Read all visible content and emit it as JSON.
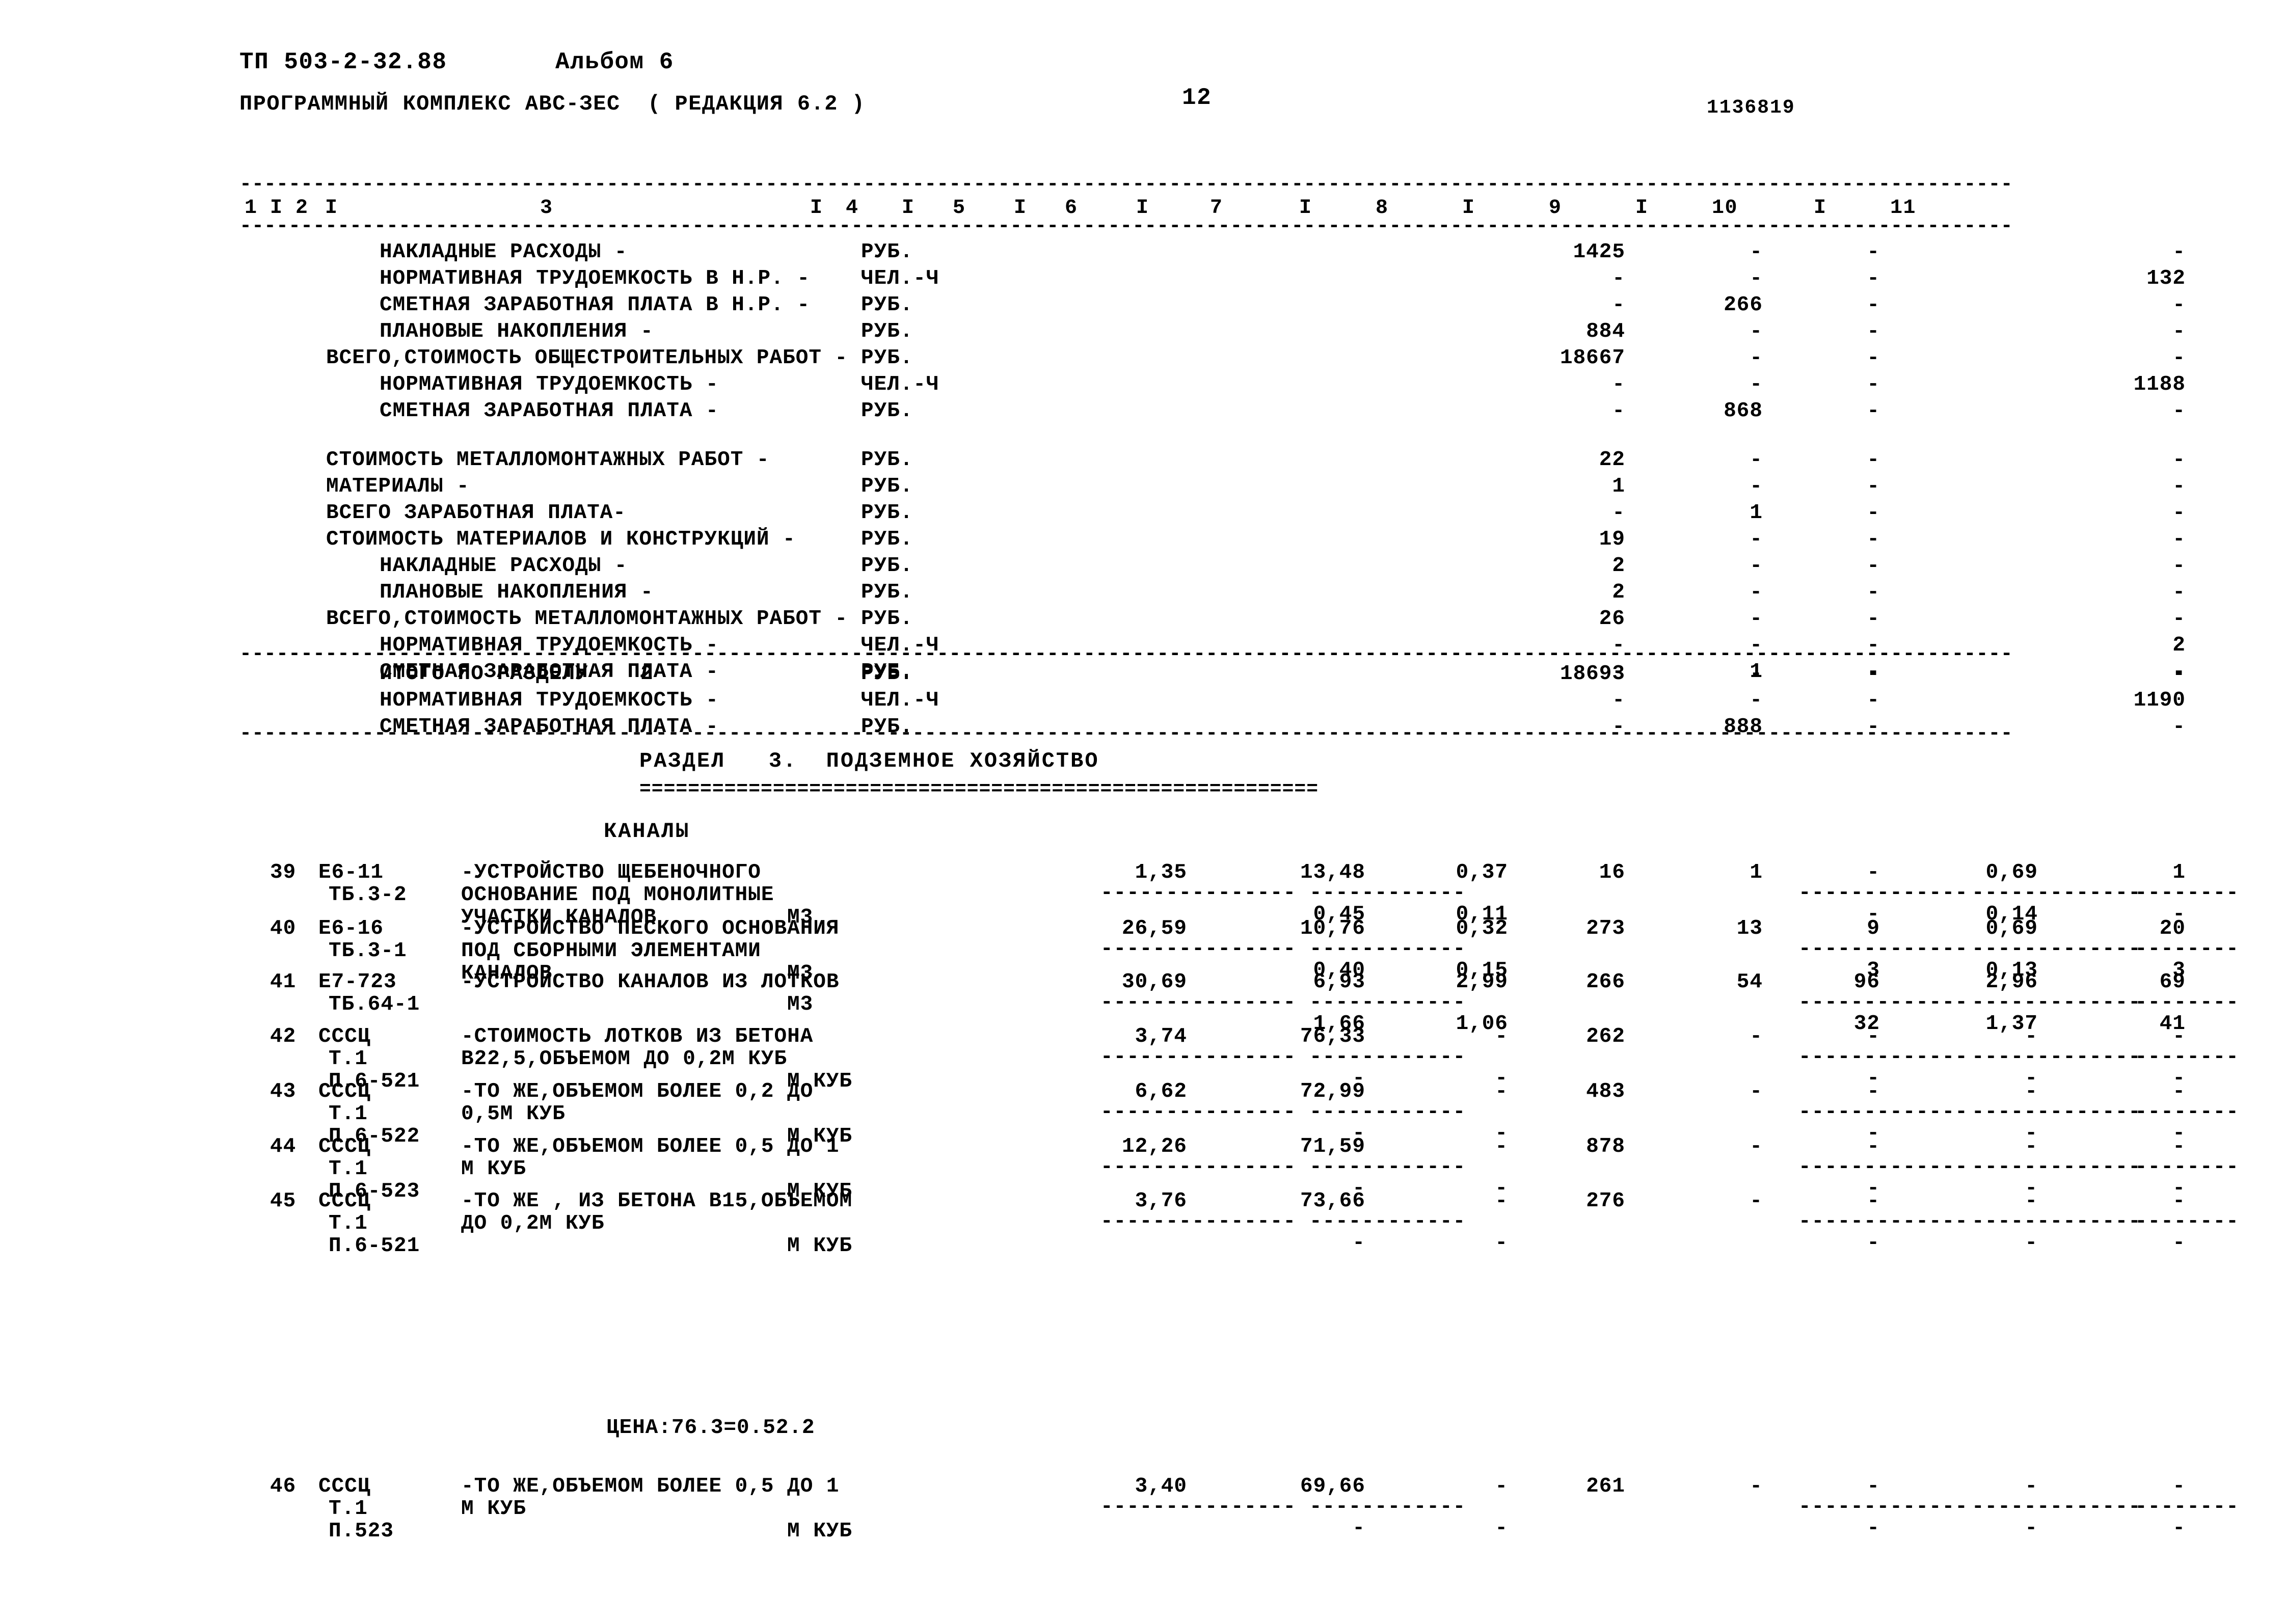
{
  "document": {
    "code": "ТП 503-2-32.88",
    "album": "Альбом 6",
    "program": "ПРОГРАММНЫЙ КОМПЛЕКС АВС-ЗЕС  ( РЕДАКЦИЯ 6.2 )",
    "page_number": "12",
    "doc_number": "1136819",
    "dash_rule": "-------------------------------------------------------------------------------------------------------------------------------------------------"
  },
  "columns": {
    "numbers": [
      "1",
      "2",
      "3",
      "4",
      "5",
      "6",
      "7",
      "8",
      "9",
      "10",
      "11"
    ],
    "separator": "I"
  },
  "summary_block_1": {
    "rows": [
      {
        "label": "НАКЛАДНЫЕ РАСХОДЫ -",
        "indent": 1,
        "unit": "РУБ.",
        "c7": "1425",
        "c8": "-",
        "c9": "-",
        "c10": "",
        "c11": "-"
      },
      {
        "label": "НОРМАТИВНАЯ ТРУДОЕМКОСТЬ В Н.Р. -",
        "indent": 1,
        "unit": "ЧЕЛ.-Ч",
        "c7": "-",
        "c8": "-",
        "c9": "-",
        "c10": "",
        "c11": "132"
      },
      {
        "label": "СМЕТНАЯ ЗАРАБОТНАЯ ПЛАТА В Н.Р. -",
        "indent": 1,
        "unit": "РУБ.",
        "c7": "-",
        "c8": "266",
        "c9": "-",
        "c10": "",
        "c11": "-"
      },
      {
        "label": "ПЛАНОВЫЕ НАКОПЛЕНИЯ -",
        "indent": 1,
        "unit": "РУБ.",
        "c7": "884",
        "c8": "-",
        "c9": "-",
        "c10": "",
        "c11": "-"
      },
      {
        "label": "ВСЕГО,СТОИМОСТЬ ОБЩЕСТРОИТЕЛЬНЫХ РАБОТ -",
        "indent": 0,
        "unit": "РУБ.",
        "c7": "18667",
        "c8": "-",
        "c9": "-",
        "c10": "",
        "c11": "-"
      },
      {
        "label": "НОРМАТИВНАЯ ТРУДОЕМКОСТЬ -",
        "indent": 1,
        "unit": "ЧЕЛ.-Ч",
        "c7": "-",
        "c8": "-",
        "c9": "-",
        "c10": "",
        "c11": "1188"
      },
      {
        "label": "СМЕТНАЯ ЗАРАБОТНАЯ ПЛАТА -",
        "indent": 1,
        "unit": "РУБ.",
        "c7": "-",
        "c8": "868",
        "c9": "-",
        "c10": "",
        "c11": "-"
      }
    ]
  },
  "summary_block_2": {
    "rows": [
      {
        "label": "СТОИМОСТЬ МЕТАЛЛОМОНТАЖНЫХ РАБОТ -",
        "indent": 0,
        "unit": "РУБ.",
        "c7": "22",
        "c8": "-",
        "c9": "-",
        "c10": "",
        "c11": "-"
      },
      {
        "label": "МАТЕРИАЛЫ -",
        "indent": 0,
        "unit": "РУБ.",
        "c7": "1",
        "c8": "-",
        "c9": "-",
        "c10": "",
        "c11": "-"
      },
      {
        "label": "ВСЕГО ЗАРАБОТНАЯ ПЛАТА-",
        "indent": 0,
        "unit": "РУБ.",
        "c7": "-",
        "c8": "1",
        "c9": "-",
        "c10": "",
        "c11": "-"
      },
      {
        "label": "СТОИМОСТЬ МАТЕРИАЛОВ И КОНСТРУКЦИЙ -",
        "indent": 0,
        "unit": "РУБ.",
        "c7": "19",
        "c8": "-",
        "c9": "-",
        "c10": "",
        "c11": "-"
      },
      {
        "label": "НАКЛАДНЫЕ РАСХОДЫ -",
        "indent": 1,
        "unit": "РУБ.",
        "c7": "2",
        "c8": "-",
        "c9": "-",
        "c10": "",
        "c11": "-"
      },
      {
        "label": "ПЛАНОВЫЕ НАКОПЛЕНИЯ -",
        "indent": 1,
        "unit": "РУБ.",
        "c7": "2",
        "c8": "-",
        "c9": "-",
        "c10": "",
        "c11": "-"
      },
      {
        "label": "ВСЕГО,СТОИМОСТЬ МЕТАЛЛОМОНТАЖНЫХ РАБОТ -",
        "indent": 0,
        "unit": "РУБ.",
        "c7": "26",
        "c8": "-",
        "c9": "-",
        "c10": "",
        "c11": "-"
      },
      {
        "label": "НОРМАТИВНАЯ ТРУДОЕМКОСТЬ -",
        "indent": 1,
        "unit": "ЧЕЛ.-Ч",
        "c7": "-",
        "c8": "-",
        "c9": "-",
        "c10": "",
        "c11": "2"
      },
      {
        "label": "СМЕТНАЯ ЗАРАБОТНАЯ ПЛАТА -",
        "indent": 1,
        "unit": "РУБ.",
        "c7": "-",
        "c8": "1",
        "c9": "-",
        "c10": "",
        "c11": "-"
      }
    ]
  },
  "totals_block": {
    "rows": [
      {
        "label": "ИТОГО ПО РАЗДЕЛУ    2",
        "indent": 1,
        "unit": "РУБ.",
        "c7": "18693",
        "c8": "-",
        "c9": "-",
        "c10": "",
        "c11": "-"
      },
      {
        "label": "НОРМАТИВНАЯ ТРУДОЕМКОСТЬ -",
        "indent": 1,
        "unit": "ЧЕЛ.-Ч",
        "c7": "-",
        "c8": "-",
        "c9": "-",
        "c10": "",
        "c11": "1190"
      },
      {
        "label": "СМЕТНАЯ ЗАРАБОТНАЯ ПЛАТА -",
        "indent": 1,
        "unit": "РУБ.",
        "c7": "-",
        "c8": "888",
        "c9": "-",
        "c10": "",
        "c11": "-"
      }
    ]
  },
  "section": {
    "title": "РАЗДЕЛ   3.  ПОДЗЕМНОЕ ХОЗЯЙСТВО",
    "underline": "========================================================",
    "subtitle": "КАНАЛЫ"
  },
  "items": [
    {
      "no": "39",
      "code1": "Е6-11",
      "code2": "ТБ.3-2",
      "desc": [
        "-УСТРОЙСТВО ЩЕБЕНОЧНОГО",
        "ОСНОВАНИЕ ПОД МОНОЛИТНЫЕ",
        "УЧАСТКИ КАНАЛОВ"
      ],
      "unit": "М3",
      "unit_line": 3,
      "c4": "1,35",
      "c5": "13,48",
      "c6": "0,37",
      "c7": "16",
      "c8": "1",
      "c9": "-",
      "c10": "0,69",
      "c11": "1",
      "sub_c5": "0,45",
      "sub_c6": "0,11",
      "sub_c9": "-",
      "sub_c10": "0,14",
      "sub_c11": "-"
    },
    {
      "no": "40",
      "code1": "Е6-16",
      "code2": "ТБ.3-1",
      "desc": [
        "-УСТРОЙСТВО ПЕСКОГО ОСНОВАНИЯ",
        "ПОД СБОРНЫМИ ЭЛЕМЕНТАМИ",
        "КАНАЛОВ"
      ],
      "unit": "М3",
      "unit_line": 3,
      "c4": "26,59",
      "c5": "10,76",
      "c6": "0,32",
      "c7": "273",
      "c8": "13",
      "c9": "9",
      "c10": "0,69",
      "c11": "20",
      "sub_c5": "0,40",
      "sub_c6": "0,15",
      "sub_c9": "3",
      "sub_c10": "0,13",
      "sub_c11": "3"
    },
    {
      "no": "41",
      "code1": "Е7-723",
      "code2": "ТБ.64-1",
      "desc": [
        "-УСТРОЙСТВО КАНАЛОВ ИЗ ЛОТКОВ"
      ],
      "unit": "М3",
      "unit_line": 2,
      "c4": "30,69",
      "c5": "6,93",
      "c6": "2,99",
      "c7": "266",
      "c8": "54",
      "c9": "96",
      "c10": "2,96",
      "c11": "69",
      "sub_c5": "1,66",
      "sub_c6": "1,06",
      "sub_c9": "32",
      "sub_c10": "1,37",
      "sub_c11": "41"
    },
    {
      "no": "42",
      "code1": "СССЦ",
      "code2": "Т.1",
      "code3": "П.6-521",
      "desc": [
        "-СТОИМОСТЬ ЛОТКОВ ИЗ БЕТОНА",
        "В22,5,ОБЪЕМОМ ДО 0,2М КУБ"
      ],
      "unit": "М КУБ",
      "unit_line": 3,
      "c4": "3,74",
      "c5": "76,33",
      "c6": "-",
      "c7": "262",
      "c8": "-",
      "c9": "-",
      "c10": "-",
      "c11": "-",
      "sub_c5": "-",
      "sub_c6": "-",
      "sub_c9": "-",
      "sub_c10": "-",
      "sub_c11": "-"
    },
    {
      "no": "43",
      "code1": "СССЦ",
      "code2": "Т.1",
      "code3": "П.6-522",
      "desc": [
        "-ТО ЖЕ,ОБЪЕМОМ БОЛЕЕ 0,2 ДО",
        "0,5М КУБ"
      ],
      "unit": "М КУБ",
      "unit_line": 3,
      "c4": "6,62",
      "c5": "72,99",
      "c6": "-",
      "c7": "483",
      "c8": "-",
      "c9": "-",
      "c10": "-",
      "c11": "-",
      "sub_c5": "-",
      "sub_c6": "-",
      "sub_c9": "-",
      "sub_c10": "-",
      "sub_c11": "-"
    },
    {
      "no": "44",
      "code1": "СССЦ",
      "code2": "Т.1",
      "code3": "П.6-523",
      "desc": [
        "-ТО ЖЕ,ОБЪЕМОМ БОЛЕЕ 0,5 ДО 1",
        "М КУБ"
      ],
      "unit": "М КУБ",
      "unit_line": 3,
      "c4": "12,26",
      "c5": "71,59",
      "c6": "-",
      "c7": "878",
      "c8": "-",
      "c9": "-",
      "c10": "-",
      "c11": "-",
      "sub_c5": "-",
      "sub_c6": "-",
      "sub_c9": "-",
      "sub_c10": "-",
      "sub_c11": "-"
    },
    {
      "no": "45",
      "code1": "СССЦ",
      "code2": "Т.1",
      "code3": "П.6-521",
      "desc": [
        "-ТО ЖЕ , ИЗ БЕТОНА В15,ОБЪЕМОМ",
        "ДО 0,2М КУБ"
      ],
      "unit": "М КУБ",
      "unit_line": 3,
      "c4": "3,76",
      "c5": "73,66",
      "c6": "-",
      "c7": "276",
      "c8": "-",
      "c9": "-",
      "c10": "-",
      "c11": "-",
      "sub_c5": "-",
      "sub_c6": "-",
      "sub_c9": "-",
      "sub_c10": "-",
      "sub_c11": "-"
    }
  ],
  "price_note": "ЦЕНА:76.3=0.52.2",
  "item_last": {
    "no": "46",
    "code1": "СССЦ",
    "code2": "Т.1",
    "code3": "П.523",
    "desc": [
      "-ТО ЖЕ,ОБЪЕМОМ БОЛЕЕ 0,5 ДО 1",
      "М КУБ"
    ],
    "unit": "М КУБ",
    "unit_line": 3,
    "c4": "3,40",
    "c5": "69,66",
    "c6": "-",
    "c7": "261",
    "c8": "-",
    "c9": "-",
    "c10": "-",
    "c11": "-",
    "sub_c5": "-",
    "sub_c6": "-",
    "sub_c9": "-",
    "sub_c10": "-",
    "sub_c11": "-"
  }
}
